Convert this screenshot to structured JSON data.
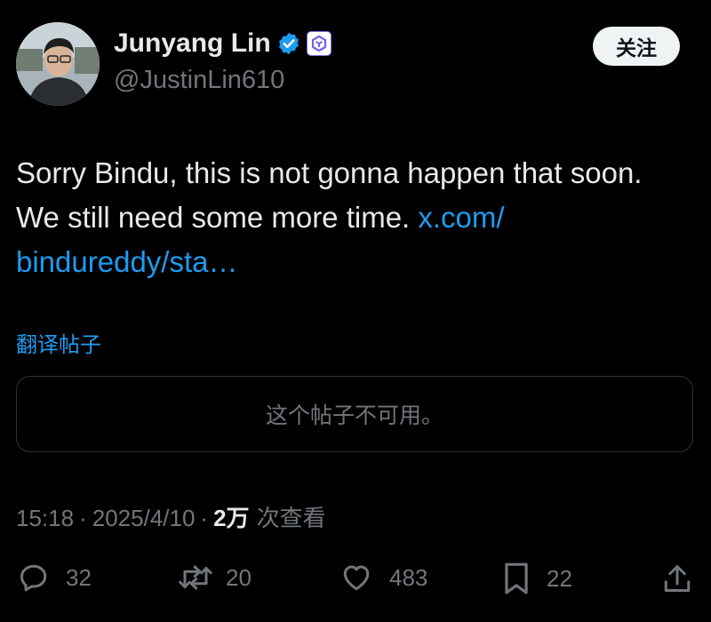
{
  "author": {
    "name": "Junyang Lin",
    "handle": "@JustinLin610",
    "verified_color": "#1d9bf0"
  },
  "follow_button": {
    "label": "关注"
  },
  "tweet": {
    "text": "Sorry Bindu, this is not gonna happen that soon. We still need some more time.",
    "link_text": "x.com/ bindureddy/sta…",
    "link_color": "#1d9bf0"
  },
  "translate_link": "翻译帖子",
  "quoted_post": {
    "message": "这个帖子不可用。"
  },
  "meta": {
    "time": "15:18",
    "separator": "·",
    "date": "2025/4/10",
    "views": "2万",
    "views_label": "次查看"
  },
  "actions": {
    "reply": {
      "icon": "reply-icon",
      "count": "32"
    },
    "retweet": {
      "icon": "retweet-icon",
      "count": "20"
    },
    "like": {
      "icon": "heart-icon",
      "count": "483"
    },
    "bookmark": {
      "icon": "bookmark-icon",
      "count": "22"
    },
    "share": {
      "icon": "share-icon"
    }
  }
}
